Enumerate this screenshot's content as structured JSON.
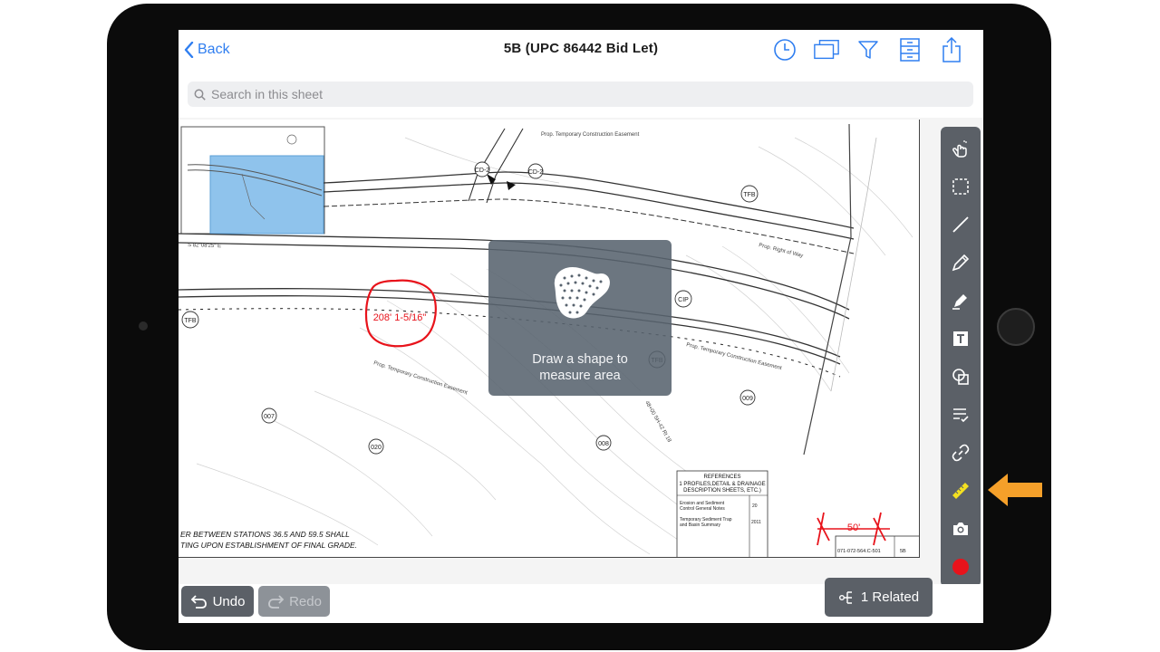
{
  "navbar": {
    "back_label": "Back",
    "title": "5B (UPC 86442 Bid Let)",
    "icons": [
      "clock-icon",
      "sheets-icon",
      "filter-icon",
      "cabinet-icon",
      "share-icon"
    ]
  },
  "search": {
    "placeholder": "Search in this sheet"
  },
  "drawing": {
    "measurement_label": "208' 1-5/16\"",
    "scale_label": "50'",
    "references_title": "REFERENCES",
    "references_lines": [
      "1 PROFILES,DETAIL & DRAINAGE",
      "DESCRIPTION SHEETS, ETC.)"
    ],
    "references_items": [
      [
        "Erosion and Sediment Control General Notes",
        "20"
      ],
      [
        "Temporary Sediment Trap and Basin Summary",
        "2011"
      ]
    ],
    "notes": [
      "ER BETWEEN STATIONS 36.5 AND 59.5 SHALL",
      "TING UPON ESTABLISHMENT OF FINAL GRADE."
    ],
    "bearing_label": "S 82°08'25\" E",
    "markers": [
      "TFB",
      "TFB",
      "CD-2",
      "CD-2",
      "CIP",
      "TFB",
      "007",
      "020",
      "008",
      "009"
    ],
    "sheet_ref": "071-072-564.C-501",
    "sheet_no": "5B"
  },
  "overlay": {
    "icon": "area-shape-icon",
    "line1": "Draw a shape to",
    "line2": "measure area"
  },
  "toolbar": {
    "tools": [
      "select-hand-icon",
      "lasso-select-icon",
      "line-icon",
      "pen-icon",
      "highlighter-icon",
      "text-icon",
      "shapes-icon",
      "checklist-icon",
      "link-icon",
      "measure-ruler-icon",
      "camera-icon",
      "color-dot-icon"
    ],
    "active_color": "#e8131b",
    "ruler_color": "#f4e020"
  },
  "bottom": {
    "undo_label": "Undo",
    "redo_label": "Redo",
    "related_label": "1 Related"
  },
  "colors": {
    "accent": "#2f7ef0",
    "toolbar_bg": "#5b6067",
    "markup_red": "#e8131b",
    "pointer_arrow": "#f5a02a"
  }
}
